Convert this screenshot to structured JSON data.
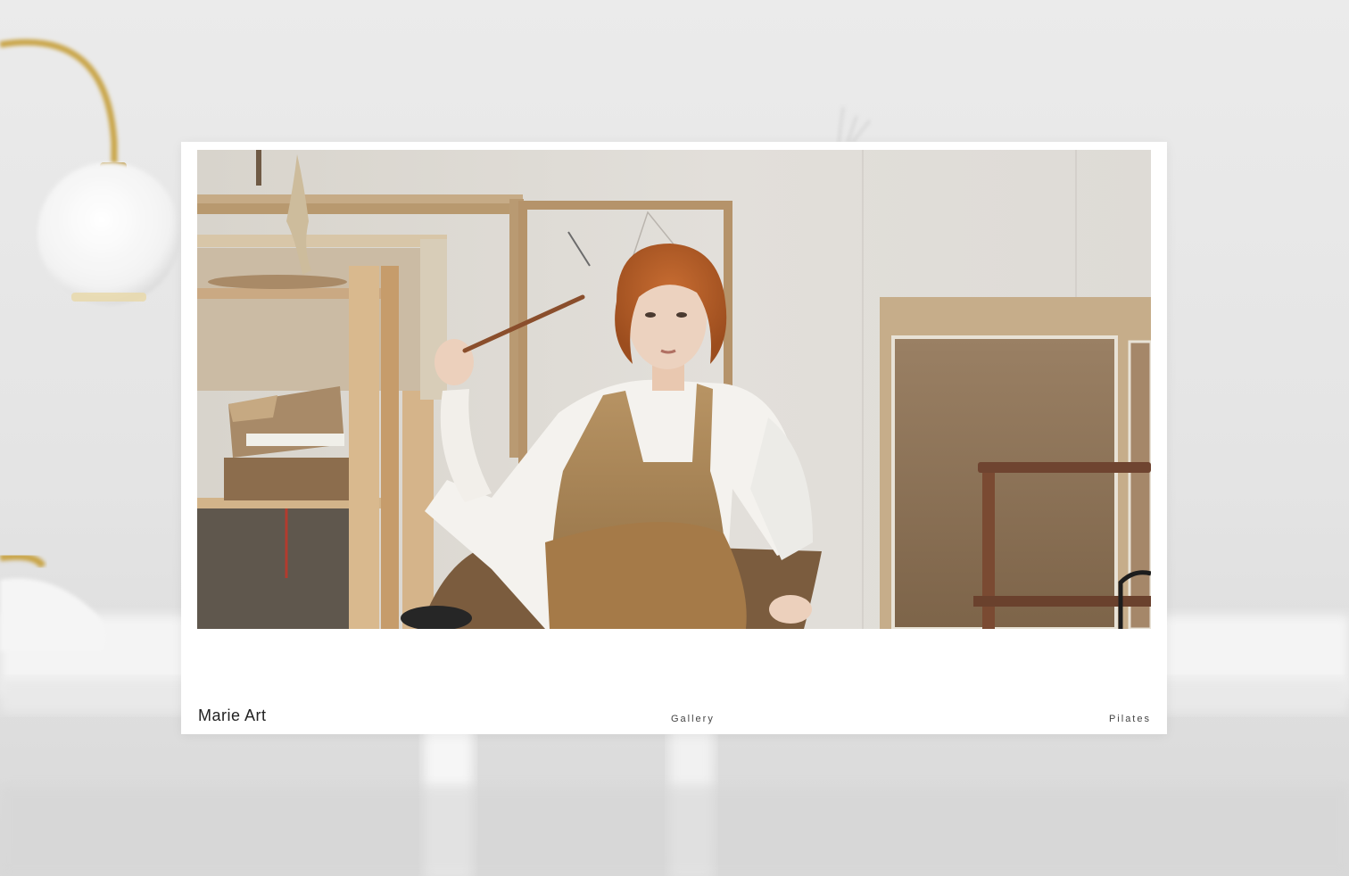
{
  "site": {
    "brand": "Marie Art"
  },
  "nav": {
    "items": [
      {
        "label": "Gallery"
      },
      {
        "label": "Pilates"
      }
    ]
  },
  "hero": {
    "subject": "artist-in-studio-photo"
  },
  "background": {
    "subject": "blurred-room-with-lamps-photo"
  },
  "colors": {
    "backdrop": "#e6e6e6",
    "card": "#ffffff",
    "text": "#222222",
    "lamp_brass": "#c9a54a"
  }
}
